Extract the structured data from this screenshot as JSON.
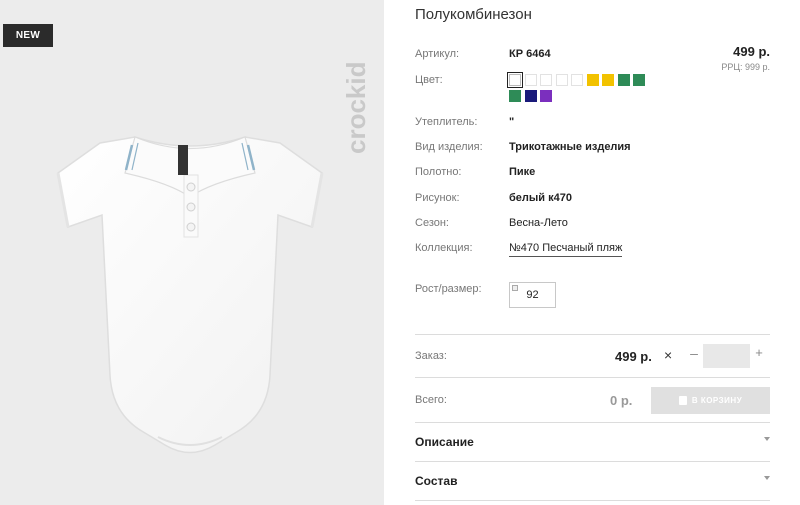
{
  "product": {
    "badge": "NEW",
    "brand": "crockid",
    "title": "Полукомбинезон",
    "price": "499 р.",
    "rrp": "РРЦ: 999 р."
  },
  "details": {
    "article_label": "Артикул:",
    "article_value": "КР 6464",
    "color_label": "Цвет:",
    "colors": [
      "#ffffff",
      "#ffffff",
      "#ffffff",
      "#ffffff",
      "#ffffff",
      "#f2c200",
      "#f2c200",
      "#2e8b57",
      "#2e8b57",
      "#2e8b57",
      "#1a1a7a",
      "#7b2fbe"
    ],
    "selected_color_index": 0,
    "insulation_label": "Утеплитель:",
    "insulation_value": "\"",
    "type_label": "Вид изделия:",
    "type_value": "Трикотажные изделия",
    "fabric_label": "Полотно:",
    "fabric_value": "Пике",
    "pattern_label": "Рисунок:",
    "pattern_value": "белый к470",
    "season_label": "Сезон:",
    "season_value": "Весна-Лето",
    "collection_label": "Коллекция:",
    "collection_value": "№470 Песчаный пляж",
    "size_label": "Рост/размер:",
    "size_value": "92"
  },
  "order": {
    "label": "Заказ:",
    "unit_price": "499 р.",
    "times": "×",
    "minus": "–",
    "plus": "+",
    "quantity": ""
  },
  "total": {
    "label": "Всего:",
    "value": "0 р.",
    "cart_button": "В КОРЗИНУ"
  },
  "accordion": {
    "description": "Описание",
    "composition": "Состав"
  }
}
